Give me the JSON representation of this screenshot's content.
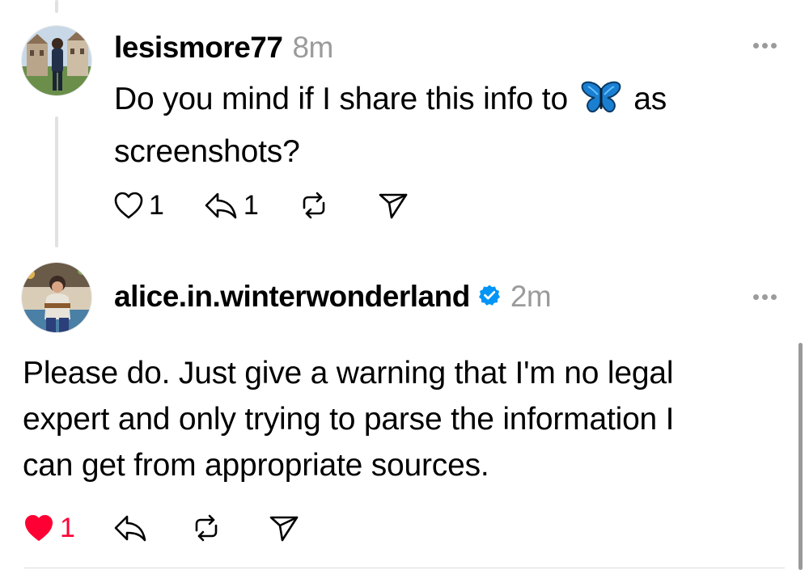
{
  "colors": {
    "text": "#000000",
    "muted": "#9b9b9b",
    "like_active": "#ff0034",
    "verified": "#0095f6",
    "thread_line": "#e1e1e1"
  },
  "posts": [
    {
      "username": "lesismore77",
      "time": "8m",
      "text_before_emoji": "Do you mind if I share this info to",
      "emoji": "butterfly",
      "text_after_emoji": "as",
      "text_line2": "screenshots?",
      "like_count": "1",
      "reply_count": "1",
      "liked": false,
      "verified": false
    },
    {
      "username": "alice.in.winterwonderland",
      "time": "2m",
      "text_lines": [
        "Please do. Just give a warning that I'm no legal",
        "expert and only trying to parse the information I",
        "can get from appropriate sources."
      ],
      "like_count": "1",
      "liked": true,
      "verified": true
    }
  ],
  "icons": {
    "like": "heart-icon",
    "reply": "reply-icon",
    "repost": "repost-icon",
    "share": "send-icon",
    "more": "more-icon",
    "verified": "verified-badge-icon"
  }
}
